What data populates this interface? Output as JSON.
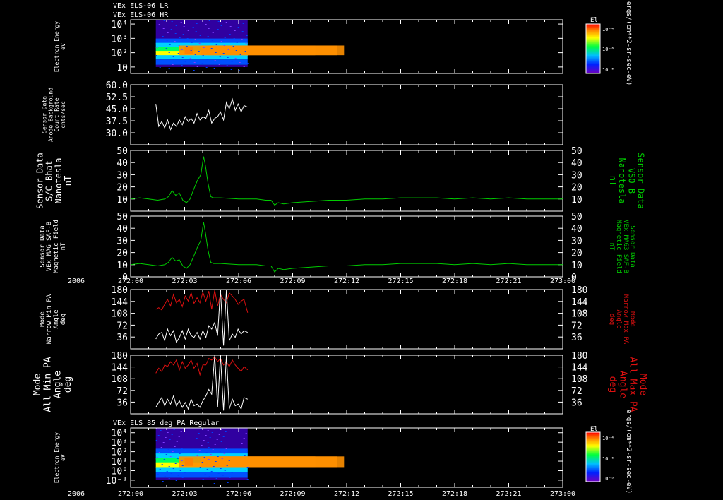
{
  "header": {
    "line1": "VEx ELS-06 LR",
    "line2": "VEx ELS-06 HR",
    "bottom_panel_title": "VEx ELS 85 deg PA Regular"
  },
  "colors": {
    "background": "#000000",
    "axis": "#ffffff",
    "bfield": "#00cc00",
    "max_pa": "#dd1010",
    "min_pa": "#ffffff",
    "right_labels_green": "#00cc00",
    "right_labels_red": "#dd1010"
  },
  "time_axis": {
    "year": "2006",
    "ticks": [
      "272:00",
      "272:03",
      "272:06",
      "272:09",
      "272:12",
      "272:15",
      "272:18",
      "272:21",
      "273:00"
    ],
    "range_minutes": [
      0,
      24
    ]
  },
  "colorbar": {
    "title": "El",
    "ticks": [
      "10⁻⁴",
      "10⁻⁶",
      "10⁻⁸"
    ],
    "units": "ergs/(cm**2-sr-sec-eV)"
  },
  "chart_data": [
    {
      "type": "heatmap",
      "id": "spectrogram-top",
      "ylabel": [
        "Electron Energy",
        "eV"
      ],
      "yticks": [
        "10⁴",
        "10³",
        "10²",
        "10"
      ],
      "time_range_minutes": [
        1.4,
        6.5
      ],
      "colorscale": [
        "#3000a0",
        "#0050ff",
        "#00d0ff",
        "#00ff60",
        "#ffff00",
        "#ff9000",
        "#ff0000"
      ]
    },
    {
      "type": "line",
      "id": "anode-background",
      "ylabel": [
        "Sensor Data",
        "Anode Background",
        "Count Rate",
        "cnts/sec"
      ],
      "yticks": [
        "60.0",
        "52.5",
        "45.0",
        "37.5",
        "30.0"
      ],
      "ylim": [
        22.5,
        60
      ],
      "color": "#ffffff",
      "x": [
        1.4,
        1.56,
        1.73,
        1.89,
        2.05,
        2.22,
        2.38,
        2.54,
        2.71,
        2.87,
        3.03,
        3.2,
        3.36,
        3.52,
        3.69,
        3.85,
        4.01,
        4.18,
        4.34,
        4.5,
        4.67,
        4.83,
        4.99,
        5.16,
        5.32,
        5.48,
        5.65,
        5.81,
        5.97,
        6.14,
        6.3,
        6.5
      ],
      "values": [
        48,
        34,
        37,
        33,
        38,
        32,
        36,
        34,
        38,
        35,
        40,
        37,
        39,
        36,
        42,
        38,
        40,
        39,
        44,
        36,
        39,
        40,
        43,
        38,
        49,
        45,
        51,
        44,
        48,
        43,
        47,
        46
      ]
    },
    {
      "type": "line",
      "id": "sc-bmag",
      "ylabel": [
        "Sensor Data",
        "S/C Bhat",
        "Nanotesla",
        "nT"
      ],
      "right_label": [
        "Sensor Data",
        "VSO B",
        "Nanotesla",
        "nT"
      ],
      "yticks": [
        "50",
        "40",
        "30",
        "20",
        "10"
      ],
      "ylim": [
        0,
        50
      ],
      "color": "#00cc00",
      "x": [
        0,
        0.5,
        1.0,
        1.5,
        1.9,
        2.1,
        2.3,
        2.5,
        2.7,
        2.9,
        3.1,
        3.3,
        3.5,
        3.7,
        3.9,
        4.05,
        4.15,
        4.3,
        4.45,
        4.6,
        5.0,
        6.0,
        7.0,
        7.5,
        7.8,
        8.0,
        8.2,
        8.5,
        9.0,
        10.0,
        11.0,
        12.0,
        13.0,
        14.0,
        15.0,
        16.0,
        17.0,
        18.0,
        19.0,
        20.0,
        21.0,
        22.0,
        23.0,
        24.0
      ],
      "values": [
        10,
        11,
        10,
        9,
        10,
        12,
        17,
        13,
        15,
        9,
        7,
        10,
        18,
        25,
        30,
        45,
        38,
        23,
        12,
        11,
        11,
        10,
        10,
        9,
        9,
        5,
        7,
        6,
        7,
        8,
        9,
        9,
        10,
        10,
        11,
        11,
        11,
        10,
        11,
        10,
        11,
        10,
        10,
        10
      ]
    },
    {
      "type": "line",
      "id": "mag-saf",
      "ylabel": [
        "Sensor Data",
        "VEx MAG SAF-B",
        "Magnetic Field",
        "nT"
      ],
      "right_label": [
        "Sensor Data",
        "VEx MAG3 SAF-B",
        "Magnetic Field",
        "nT"
      ],
      "yticks": [
        "50",
        "40",
        "30",
        "20",
        "10",
        "0"
      ],
      "ylim": [
        0,
        50
      ],
      "color": "#00cc00",
      "x": [
        0,
        0.5,
        1.0,
        1.5,
        1.9,
        2.1,
        2.3,
        2.5,
        2.7,
        2.9,
        3.1,
        3.3,
        3.5,
        3.7,
        3.9,
        4.05,
        4.15,
        4.3,
        4.45,
        4.6,
        5.0,
        6.0,
        7.0,
        7.5,
        7.8,
        8.0,
        8.2,
        8.5,
        9.0,
        10.0,
        11.0,
        12.0,
        13.0,
        14.0,
        15.0,
        16.0,
        17.0,
        18.0,
        19.0,
        20.0,
        21.0,
        22.0,
        23.0,
        24.0
      ],
      "values": [
        10,
        11,
        10,
        9,
        10,
        12,
        16,
        13,
        14,
        9,
        7,
        10,
        17,
        24,
        30,
        45,
        37,
        22,
        12,
        11,
        11,
        10,
        10,
        9,
        9,
        4,
        7,
        6,
        7,
        8,
        9,
        9,
        10,
        10,
        11,
        11,
        11,
        10,
        11,
        10,
        11,
        10,
        10,
        10
      ]
    },
    {
      "type": "line",
      "id": "narrow-pa",
      "ylabel": [
        "Mode",
        "Narrow Min PA",
        "Angle",
        "deg"
      ],
      "right_label": [
        "Mode",
        "Narrow Max PA",
        "Angle",
        "deg"
      ],
      "yticks": [
        "180",
        "144",
        "108",
        "72",
        "36"
      ],
      "ylim": [
        0,
        180
      ],
      "x": [
        1.4,
        1.56,
        1.73,
        1.89,
        2.05,
        2.22,
        2.38,
        2.54,
        2.71,
        2.87,
        3.03,
        3.2,
        3.36,
        3.52,
        3.69,
        3.85,
        4.01,
        4.18,
        4.34,
        4.5,
        4.67,
        4.83,
        4.99,
        5.16,
        5.32,
        5.48,
        5.65,
        5.81,
        5.97,
        6.14,
        6.3,
        6.5
      ],
      "series": [
        {
          "color": "#dd1010",
          "values": [
            120,
            125,
            118,
            135,
            150,
            130,
            165,
            140,
            150,
            128,
            160,
            145,
            170,
            138,
            155,
            140,
            172,
            145,
            175,
            120,
            178,
            130,
            165,
            150,
            140,
            170,
            160,
            150,
            135,
            145,
            150,
            110
          ]
        },
        {
          "color": "#ffffff",
          "values": [
            30,
            45,
            50,
            25,
            60,
            40,
            55,
            20,
            35,
            55,
            30,
            60,
            40,
            35,
            50,
            30,
            55,
            35,
            70,
            60,
            80,
            40,
            180,
            10,
            180,
            25,
            45,
            35,
            60,
            45,
            55,
            50
          ]
        }
      ]
    },
    {
      "type": "line",
      "id": "all-pa",
      "ylabel": [
        "Mode",
        "All Min PA",
        "Angle",
        "deg"
      ],
      "right_label": [
        "Mode",
        "All Max PA",
        "Angle",
        "deg"
      ],
      "yticks": [
        "180",
        "144",
        "108",
        "72",
        "36"
      ],
      "ylim": [
        0,
        180
      ],
      "x": [
        1.4,
        1.56,
        1.73,
        1.89,
        2.05,
        2.22,
        2.38,
        2.54,
        2.71,
        2.87,
        3.03,
        3.2,
        3.36,
        3.52,
        3.69,
        3.85,
        4.01,
        4.18,
        4.34,
        4.5,
        4.67,
        4.83,
        4.99,
        5.16,
        5.32,
        5.48,
        5.65,
        5.81,
        5.97,
        6.14,
        6.3,
        6.5
      ],
      "series": [
        {
          "color": "#dd1010",
          "values": [
            125,
            140,
            130,
            150,
            145,
            160,
            150,
            165,
            135,
            160,
            140,
            150,
            165,
            140,
            155,
            120,
            150,
            150,
            170,
            165,
            175,
            160,
            170,
            150,
            160,
            145,
            165,
            150,
            140,
            130,
            145,
            135
          ]
        },
        {
          "color": "#ffffff",
          "values": [
            20,
            35,
            50,
            25,
            45,
            30,
            55,
            25,
            40,
            20,
            35,
            15,
            45,
            25,
            30,
            20,
            40,
            55,
            75,
            60,
            180,
            20,
            180,
            10,
            180,
            15,
            45,
            25,
            30,
            15,
            50,
            45
          ]
        }
      ]
    },
    {
      "type": "heatmap",
      "id": "spectrogram-bottom",
      "ylabel": [
        "Electron Energy",
        "eV"
      ],
      "yticks": [
        "10⁴",
        "10³",
        "10²",
        "10¹",
        "10⁰",
        "10⁻¹"
      ],
      "time_range_minutes": [
        1.4,
        6.5
      ],
      "colorscale": [
        "#3000a0",
        "#0050ff",
        "#00d0ff",
        "#00ff60",
        "#ffff00",
        "#ff9000",
        "#ff0000"
      ]
    }
  ]
}
